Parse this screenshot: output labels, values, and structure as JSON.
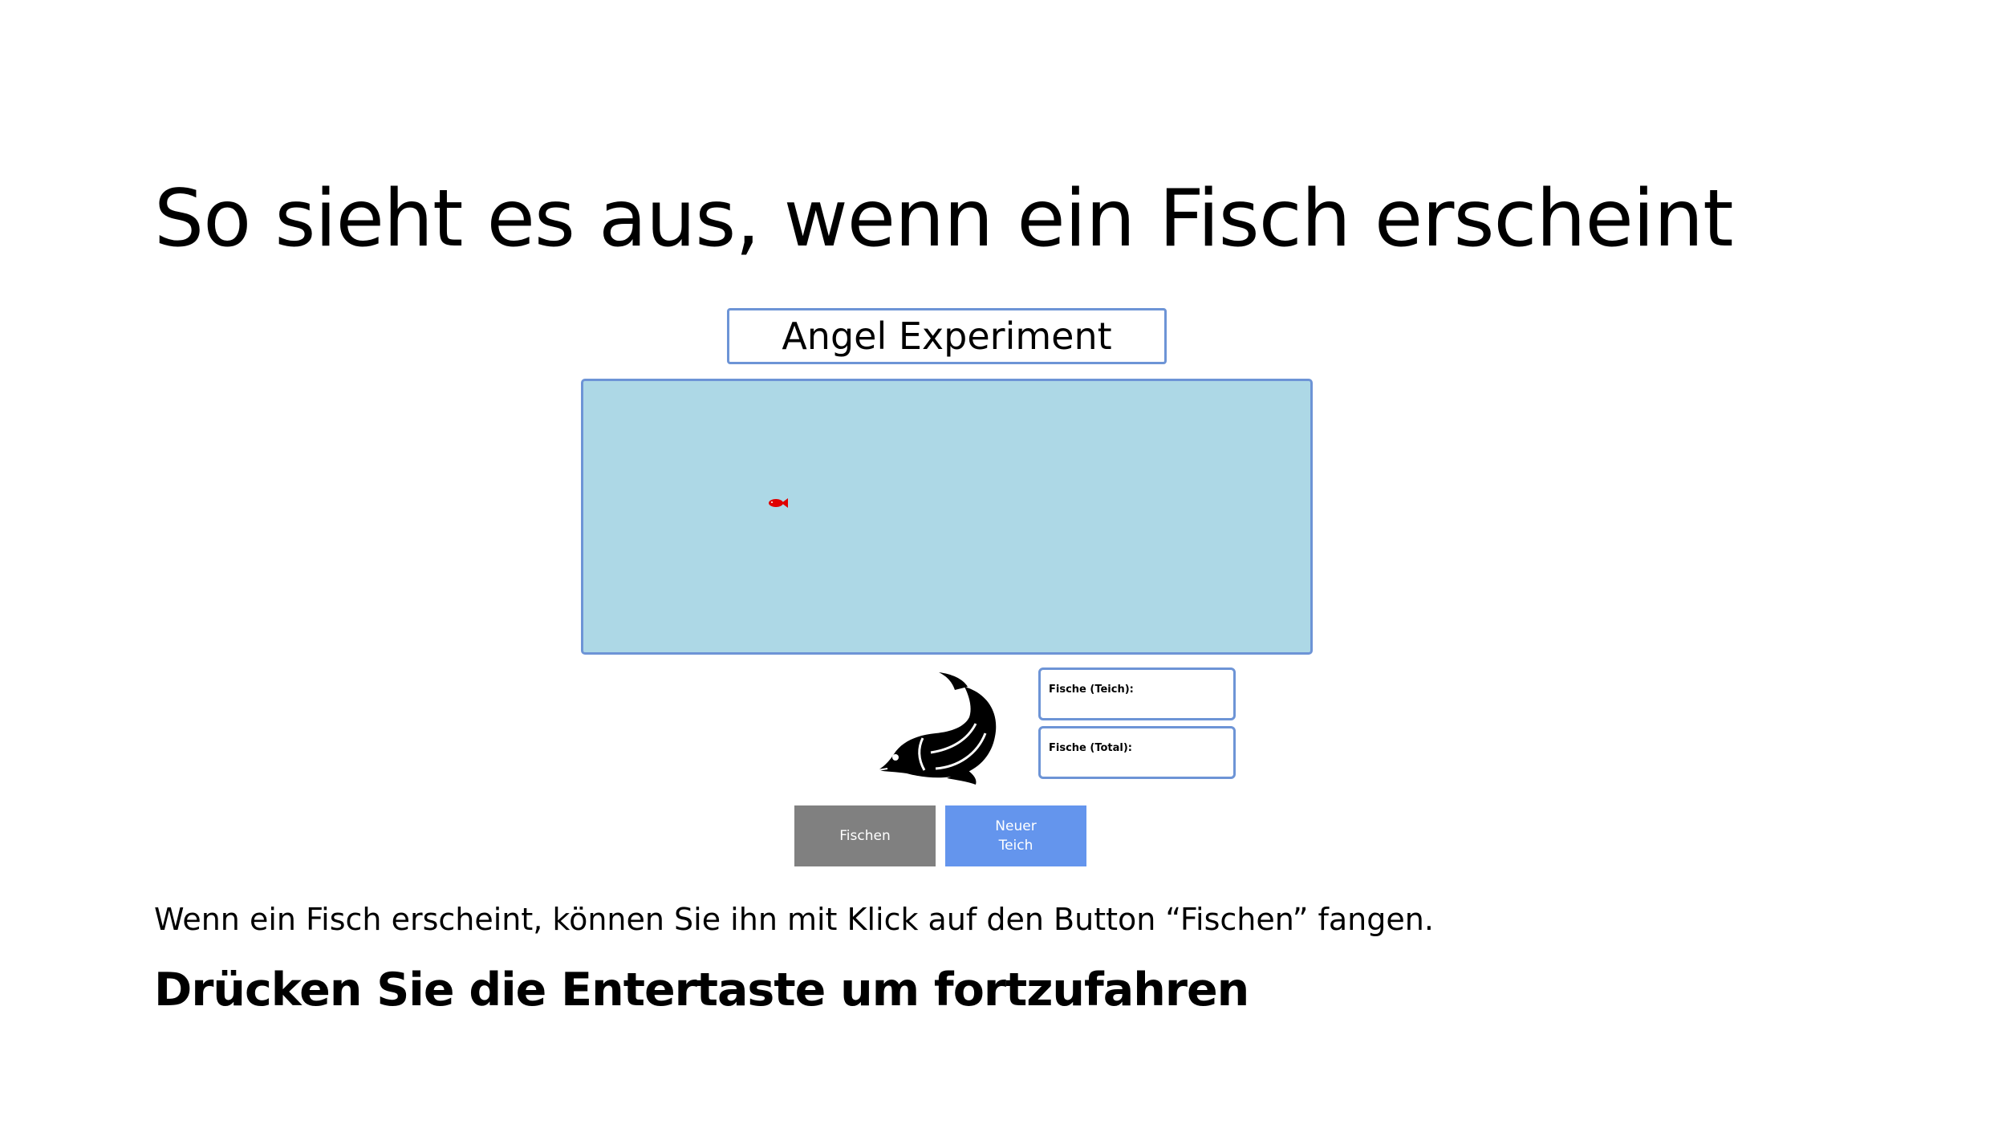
{
  "slide": {
    "title": "So sieht es aus, wenn ein Fisch erscheint",
    "instruction": "Wenn ein Fisch erscheint, können Sie ihn mit Klick auf den Button “Fischen” fangen.",
    "continue_prompt": "Drücken Sie die Entertaste um fortzufahren"
  },
  "app": {
    "title": "Angel Experiment",
    "pond": {
      "color": "#add8e6",
      "border_color": "#6d94d6",
      "fish_icon": "small-red-fish-icon",
      "fish_color": "#e00000"
    },
    "logo_icon": "fish-silhouette-icon",
    "counters": [
      {
        "label": "Fische (Teich):"
      },
      {
        "label": "Fische (Total):"
      }
    ],
    "buttons": {
      "fischen": {
        "label": "Fischen",
        "color": "#808080"
      },
      "neuer_teich": {
        "label": "Neuer\nTeich",
        "color": "#6495ed"
      }
    }
  }
}
